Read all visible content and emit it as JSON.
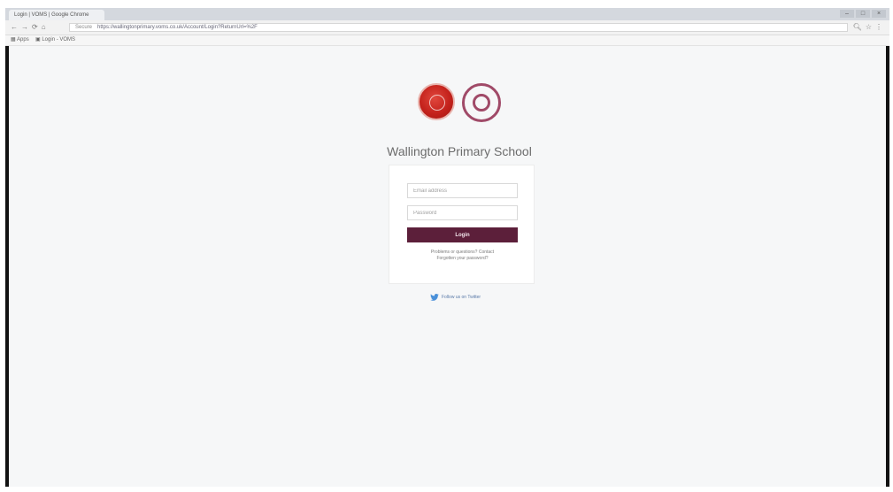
{
  "browser": {
    "tab_title": "Login | VOMS | Google Chrome",
    "window_controls": [
      "–",
      "□",
      "×"
    ],
    "address": {
      "secure_label": "Secure",
      "url": "https://wallingtonprimary.voms.co.uk/Account/Login?ReturnUrl=%2F"
    },
    "bookmarks": [
      "Apps",
      "Login - VOMS"
    ],
    "nav_icons": [
      "back-icon",
      "forward-icon",
      "reload-icon",
      "home-icon"
    ]
  },
  "page": {
    "school_name": "Wallington Primary School",
    "email_placeholder": "Email address",
    "password_placeholder": "Password",
    "login_label": "Login",
    "help_line_1": "Problems or questions? Contact",
    "help_line_2": "Forgotten your password?",
    "twitter_text": "Follow us on Twitter"
  },
  "colors": {
    "accent": "#5c1f3a",
    "crest_red": "#c4221c",
    "ring_purple": "#a04a68",
    "page_background": "#f6f7f8"
  }
}
